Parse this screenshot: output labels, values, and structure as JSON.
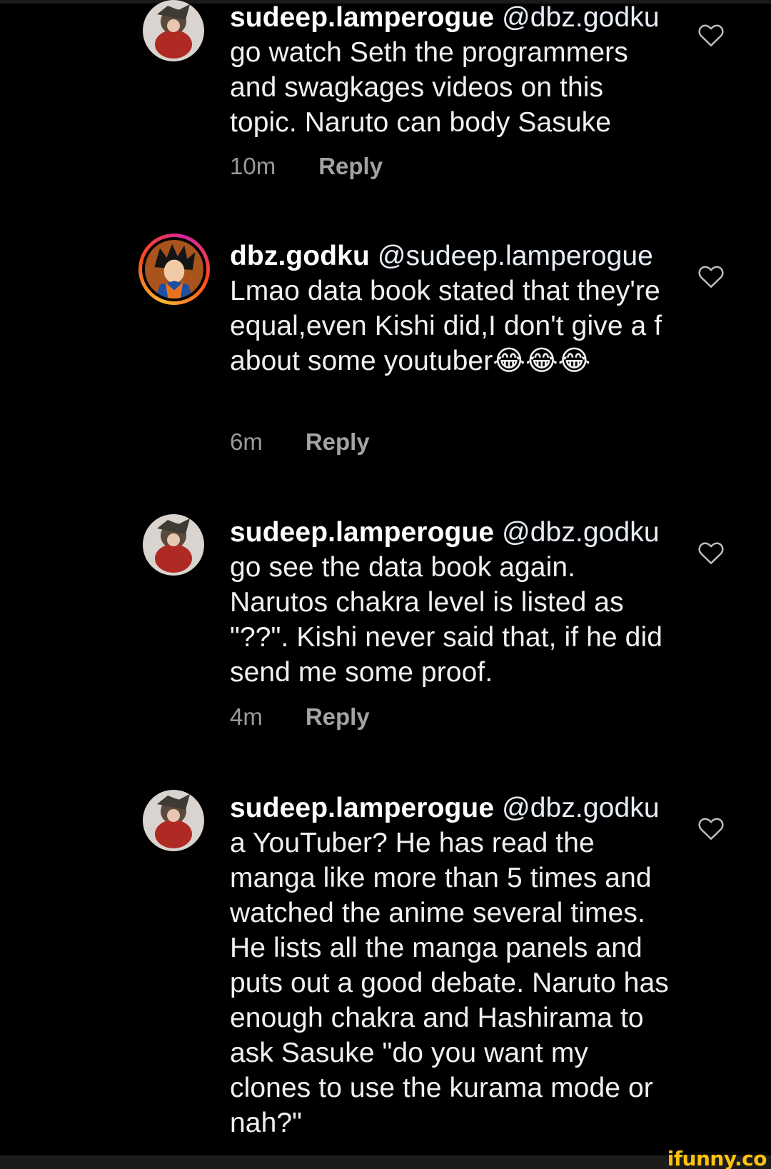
{
  "comments": [
    {
      "username": "sudeep.lamperogue",
      "mention": "@dbz.godku",
      "text": "go watch Seth the programmers and swagkages videos on this topic. Naruto can body Sasuke",
      "time": "10m",
      "reply_label": "Reply",
      "avatar_icon": "anime-character-avatar-icon"
    },
    {
      "username": "dbz.godku",
      "mention": "@sudeep.lamperogue",
      "text": "Lmao data book stated that they're equal,even Kishi did,I don't give a f about some youtuber😂😂😂",
      "time": "6m",
      "reply_label": "Reply",
      "avatar_icon": "goku-avatar-icon"
    },
    {
      "username": "sudeep.lamperogue",
      "mention": "@dbz.godku",
      "text": "go see the data book again. Narutos chakra level is listed as \"??\". Kishi never said that, if he did send me some proof.",
      "time": "4m",
      "reply_label": "Reply",
      "avatar_icon": "anime-character-avatar-icon"
    },
    {
      "username": "sudeep.lamperogue",
      "mention": "@dbz.godku",
      "text": "a YouTuber? He has read the manga like more than 5 times and watched the anime several times. He lists all the manga panels and puts out a good debate. Naruto has enough chakra and Hashirama to ask Sasuke \"do you want my clones to use the kurama mode or nah?\"",
      "avatar_icon": "anime-character-avatar-icon"
    }
  ],
  "watermark": "ifunny.co",
  "colors": {
    "background": "#000000",
    "text": "#f0f0f0",
    "meta": "#9a9a9a",
    "watermark": "#ffc20e"
  }
}
